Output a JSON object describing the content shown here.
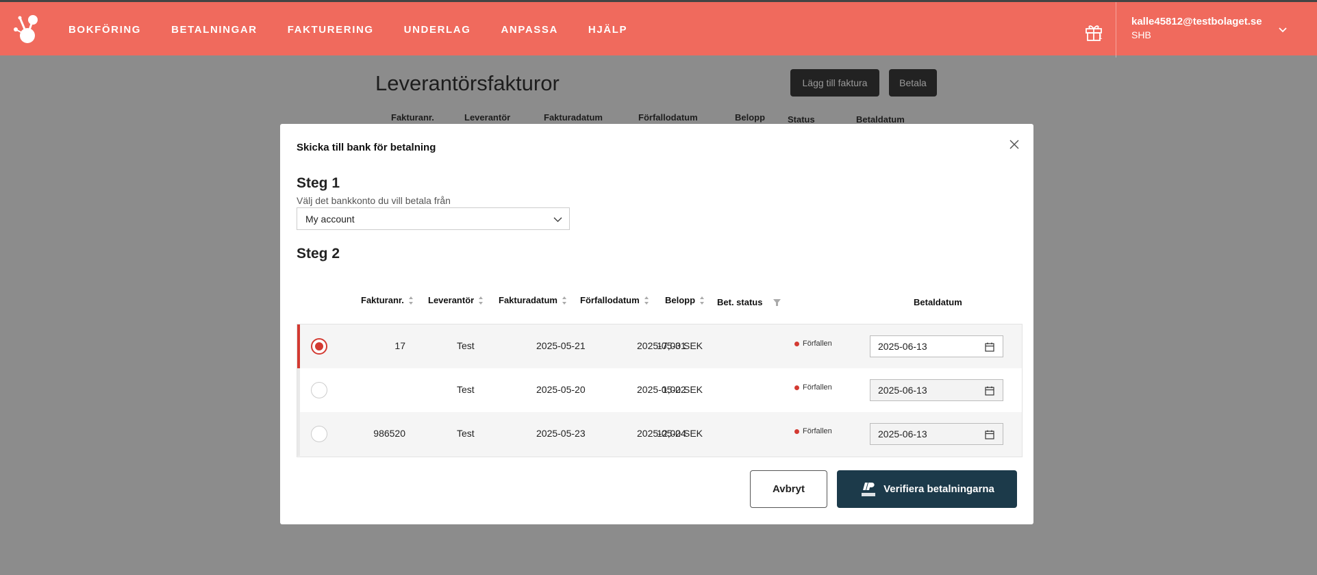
{
  "nav": {
    "items": [
      {
        "label": "BOKFÖRING"
      },
      {
        "label": "BETALNINGAR"
      },
      {
        "label": "FAKTURERING"
      },
      {
        "label": "UNDERLAG"
      },
      {
        "label": "ANPASSA"
      },
      {
        "label": "HJÄLP"
      }
    ],
    "gift_count": "1",
    "user_email": "kalle45812@testbolaget.se",
    "user_bank": "SHB"
  },
  "background": {
    "title": "Leverantörsfakturor",
    "add_invoice_button": "Lägg till faktura",
    "pay_button": "Betala",
    "headers": [
      "Fakturanr.",
      "Leverantör",
      "Fakturadatum",
      "Förfallodatum",
      "Belopp",
      "Status",
      "Betaldatum"
    ]
  },
  "modal": {
    "title": "Skicka till bank för betalning",
    "step1_title": "Steg 1",
    "step1_desc": "Välj det bankkonto du vill betala från",
    "account_selected": "My account",
    "step2_title": "Steg 2",
    "headers": {
      "invoice_no": "Fakturanr.",
      "supplier": "Leverantör",
      "invoice_date": "Fakturadatum",
      "due_date": "Förfallodatum",
      "amount": "Belopp",
      "status": "Bet. status",
      "pay_date": "Betaldatum"
    },
    "rows": [
      {
        "invoice_no": "17",
        "supplier": "Test",
        "invoice_date": "2025-05-21",
        "due_date": "2025-05-31",
        "amount": "17,00 SEK",
        "status": "Förfallen",
        "pay_date": "2025-06-13",
        "selected": true
      },
      {
        "invoice_no": "",
        "supplier": "Test",
        "invoice_date": "2025-05-20",
        "due_date": "2025-05-22",
        "amount": "1,00 SEK",
        "status": "Förfallen",
        "pay_date": "2025-06-13",
        "selected": false
      },
      {
        "invoice_no": "986520",
        "supplier": "Test",
        "invoice_date": "2025-05-23",
        "due_date": "2025-05-24",
        "amount": "12,00 SEK",
        "status": "Förfallen",
        "pay_date": "2025-06-13",
        "selected": false
      }
    ],
    "cancel_label": "Avbryt",
    "verify_label": "Verifiera betalningarna"
  },
  "colors": {
    "brand": "#f06a5d",
    "accent_red": "#d33a32",
    "verify_button": "#1c3a4a",
    "overlay": "#8c8c8c"
  }
}
